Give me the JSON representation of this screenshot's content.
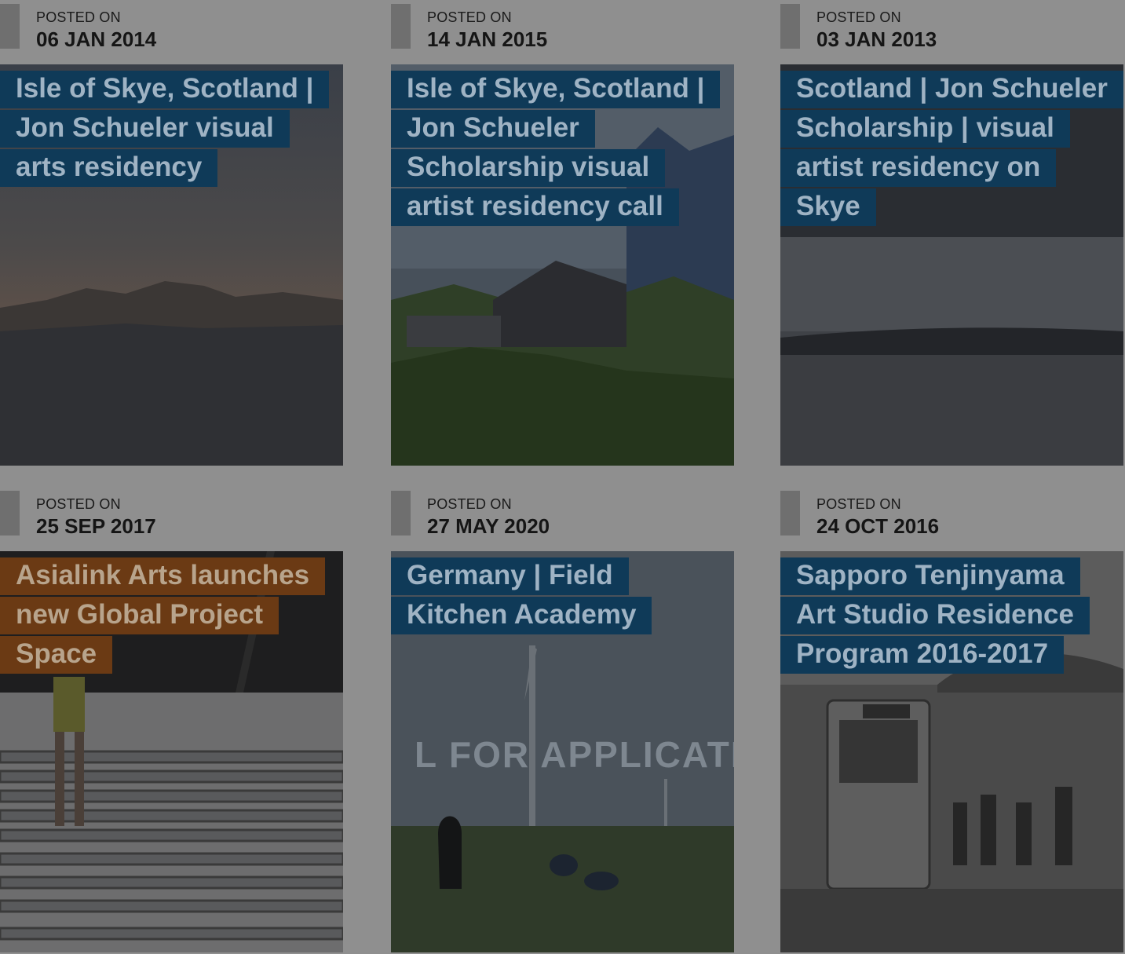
{
  "posts": [
    {
      "posted_label": "POSTED ON",
      "date": "06 JAN 2014",
      "title": "Isle of Skye, Scotland | Jon Schueler visual arts residency",
      "tag_color": "#0f3a58"
    },
    {
      "posted_label": "POSTED ON",
      "date": "14 JAN 2015",
      "title": "Isle of Skye, Scotland | Jon Schueler Scholarship visual artist residency call",
      "tag_color": "#0f3a58"
    },
    {
      "posted_label": "POSTED ON",
      "date": "03 JAN 2013",
      "title": "Scotland | Jon Schueler Scholarship | visual artist residency on Skye",
      "tag_color": "#0f3a58"
    },
    {
      "posted_label": "POSTED ON",
      "date": "25 SEP 2017",
      "title": "Asialink Arts launches new Global Project Space",
      "tag_color": "#6b3a14"
    },
    {
      "posted_label": "POSTED ON",
      "date": "27 MAY 2020",
      "title": "Germany | Field Kitchen Academy",
      "tag_color": "#0f3a58",
      "image_text": "L FOR APPLICATI"
    },
    {
      "posted_label": "POSTED ON",
      "date": "24 OCT 2016",
      "title": "Sapporo Tenjinyama Art Studio Residence Program 2016-2017",
      "tag_color": "#0f3a58"
    }
  ]
}
